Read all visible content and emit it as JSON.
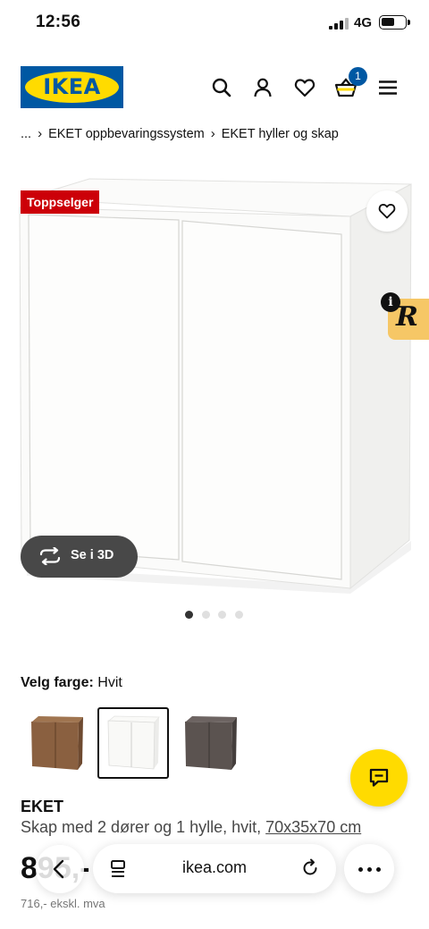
{
  "status_bar": {
    "time": "12:56",
    "network": "4G"
  },
  "header": {
    "logo_text": "IKEA",
    "cart_count": "1",
    "icons": [
      "search-icon",
      "user-icon",
      "heart-icon",
      "cart-icon",
      "menu-icon"
    ]
  },
  "breadcrumb": {
    "items": [
      "...",
      "EKET oppbevaringssystem",
      "EKET hyller og skap"
    ]
  },
  "product_image": {
    "badge": "Toppselger",
    "view3d_label": "Se i 3D",
    "carousel": {
      "total": 4,
      "active": 1
    }
  },
  "color": {
    "label": "Velg farge:",
    "selected": "Hvit",
    "swatches": [
      {
        "name": "walnut",
        "color": "#8a6040"
      },
      {
        "name": "white",
        "color": "#f7f7f5",
        "selected": true
      },
      {
        "name": "dark-grey",
        "color": "#5b5350"
      }
    ]
  },
  "product": {
    "name": "EKET",
    "description": "Skap med 2 dører og 1 hylle, hvit, ",
    "dimensions": "70x35x70 cm",
    "price": "895,-",
    "price_ex_vat": "716,- ekskl. mva"
  },
  "browser": {
    "url": "ikea.com"
  },
  "colors": {
    "ikea_blue": "#0058a3",
    "ikea_yellow": "#ffdb00",
    "badge_red": "#cc0008"
  }
}
